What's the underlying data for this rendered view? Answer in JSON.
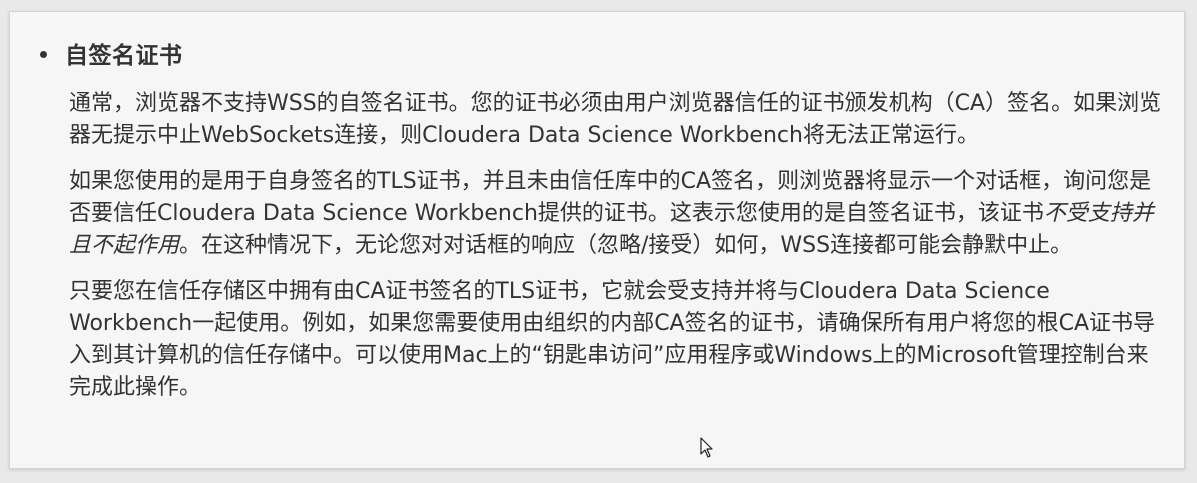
{
  "section": {
    "heading": "自签名证书",
    "paragraphs": {
      "p1": "通常，浏览器不支持WSS的自签名证书。您的证书必须由用户浏览器信任的证书颁发机构（CA）签名。如果浏览器无提示中止WebSockets连接，则Cloudera Data Science Workbench将无法正常运行。",
      "p2_before": "如果您使用的是用于自身签名的TLS证书，并且未由信任库中的CA签名，则浏览器将显示一个对话框，询问您是否要信任Cloudera Data Science Workbench提供的证书。这表示您使用的是自签名证书，该证书",
      "p2_emphasis": "不受支持并且不起作用",
      "p2_after": "。在这种情况下，无论您对对话框的响应（忽略/接受）如何，WSS连接都可能会静默中止。",
      "p3": "只要您在信任存储区中拥有由CA证书签名的TLS证书，它就会受支持并将与Cloudera Data Science Workbench一起使用。例如，如果您需要使用由组织的内部CA签名的证书，请确保所有用户将您的根CA证书导入到其计算机的信任存储中。可以使用Mac上的“钥匙串访问”应用程序或Windows上的Microsoft管理控制台来完成此操作。"
    }
  },
  "icons": {
    "bullet": "bullet-dot",
    "cursor": "mouse-pointer-icon"
  }
}
